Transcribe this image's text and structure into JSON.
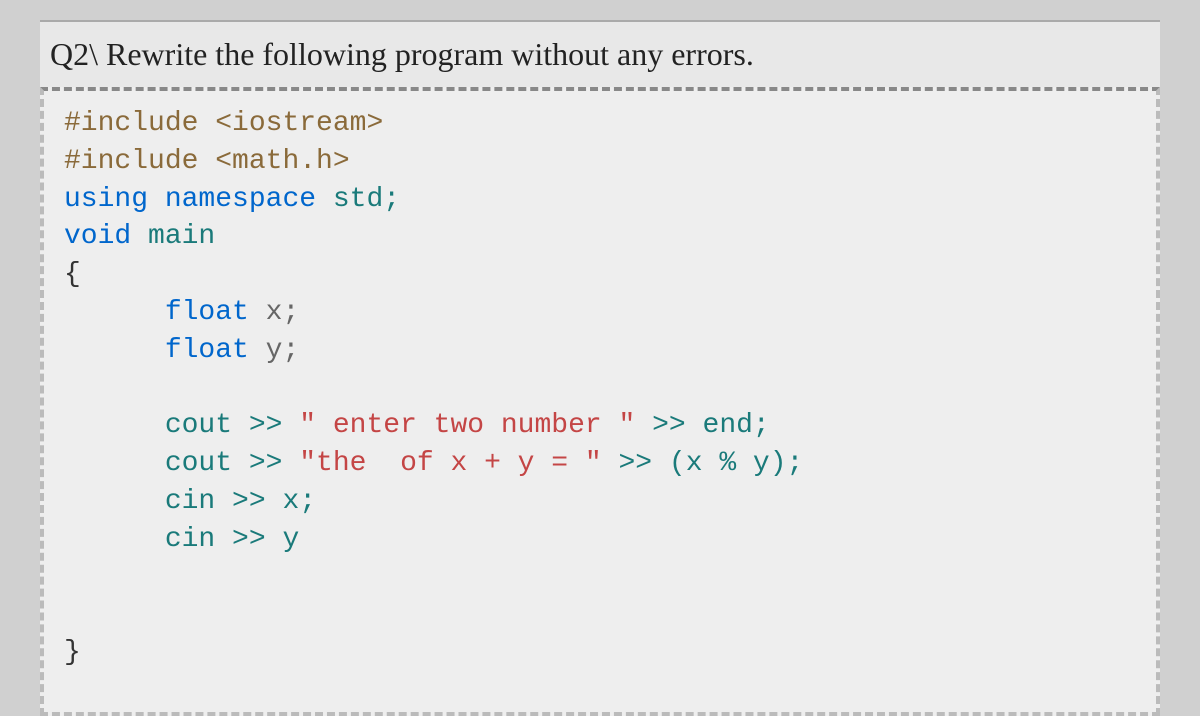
{
  "question": {
    "label": "Q2\\ Rewrite the following program without any errors."
  },
  "code": {
    "line1_pre": "#include ",
    "line1_lib": "<iostream>",
    "line2_pre": "#include ",
    "line2_lib": "<math.h>",
    "line3_using": "using ",
    "line3_ns": "namespace",
    "line3_std": " std;",
    "line4_void": "void",
    "line4_main": " main",
    "line5": "{",
    "line6_type": "float",
    "line6_var": " x;",
    "line7_type": "float",
    "line7_var": " y;",
    "blank": "",
    "line8_cout": "cout >> ",
    "line8_str": "\" enter two number \"",
    "line8_end": " >> end;",
    "line9_cout": "cout >> ",
    "line9_str": "\"the  of x + y = \"",
    "line9_end": " >> (x % y);",
    "line10": "cin >> x;",
    "line11": "cin >> y",
    "line12": "}"
  }
}
